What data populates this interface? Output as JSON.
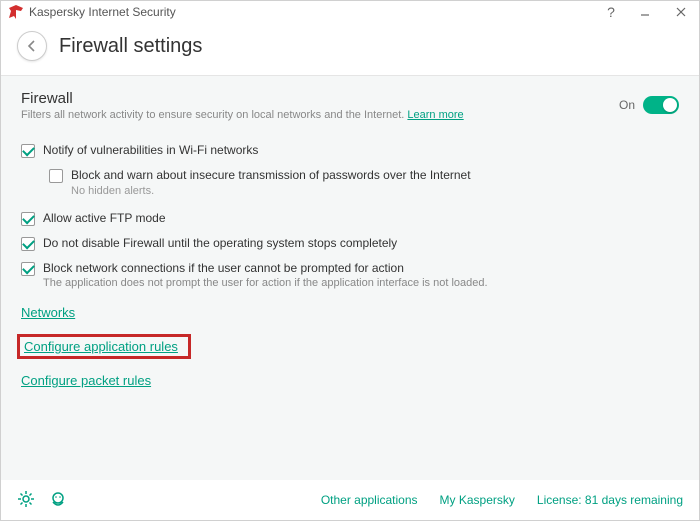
{
  "titlebar": {
    "app_name": "Kaspersky Internet Security"
  },
  "header": {
    "title": "Firewall settings"
  },
  "section": {
    "title": "Firewall",
    "description": "Filters all network activity to ensure security on local networks and the Internet.",
    "learn_more": "Learn more",
    "toggle_label": "On"
  },
  "options": {
    "notify_wifi": {
      "label": "Notify of vulnerabilities in Wi-Fi networks",
      "checked": true
    },
    "block_insecure": {
      "label": "Block and warn about insecure transmission of passwords over the Internet",
      "checked": false,
      "hint": "No hidden alerts."
    },
    "allow_ftp": {
      "label": "Allow active FTP mode",
      "checked": true
    },
    "dont_disable": {
      "label": "Do not disable Firewall until the operating system stops completely",
      "checked": true
    },
    "block_no_prompt": {
      "label": "Block network connections if the user cannot be prompted for action",
      "checked": true,
      "hint": "The application does not prompt the user for action if the application interface is not loaded."
    }
  },
  "links": {
    "networks": "Networks",
    "app_rules": "Configure application rules",
    "packet_rules": "Configure packet rules"
  },
  "footer": {
    "other_apps": "Other applications",
    "my_kaspersky": "My Kaspersky",
    "license": "License: 81 days remaining"
  }
}
